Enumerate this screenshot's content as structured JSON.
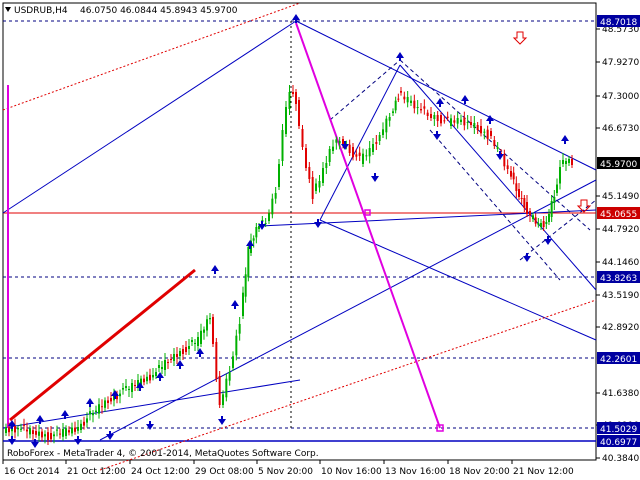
{
  "header": {
    "symbol_timeframe": "USDRUB,H4",
    "ohlc": "46.0750 46.0844 45.8943 45.9700"
  },
  "copyright": "RoboForex - MetaTrader 4, © 2001-2014, MetaQuotes Software Corp.",
  "price_axis": {
    "ticks": [
      "48.5730",
      "47.9270",
      "47.3000",
      "46.6730",
      "45.1490",
      "44.7920",
      "44.1460",
      "43.5190",
      "42.8920",
      "41.6380",
      "41.0110",
      "40.3840"
    ]
  },
  "time_axis": {
    "ticks": [
      "16 Oct 2014",
      "21 Oct 12:00",
      "24 Oct 12:00",
      "29 Oct 08:00",
      "5 Nov 20:00",
      "10 Nov 16:00",
      "13 Nov 16:00",
      "18 Nov 20:00",
      "21 Nov 12:00"
    ]
  },
  "price_tags": {
    "level_top": "48.7018",
    "current": "45.9700",
    "red_line": "45.0655",
    "level_mid": "43.8263",
    "level_low": "42.2601",
    "level_low2": "41.5029",
    "level_bottom": "40.6977"
  },
  "colors": {
    "up_candle": "#00b000",
    "down_candle": "#e00000",
    "channel": "#0000c0",
    "magenta": "#e000e0",
    "red_level": "#e00000",
    "tag_bg": "#0000a0",
    "red_tag_bg": "#cc0000"
  },
  "chart_data": {
    "type": "candlestick",
    "symbol": "USDRUB",
    "timeframe": "H4",
    "last_close": 45.97,
    "horizontal_levels": [
      48.7018,
      45.0655,
      43.8263,
      42.2601,
      41.5029,
      40.6977
    ],
    "price_range": [
      40.38,
      48.9
    ]
  }
}
